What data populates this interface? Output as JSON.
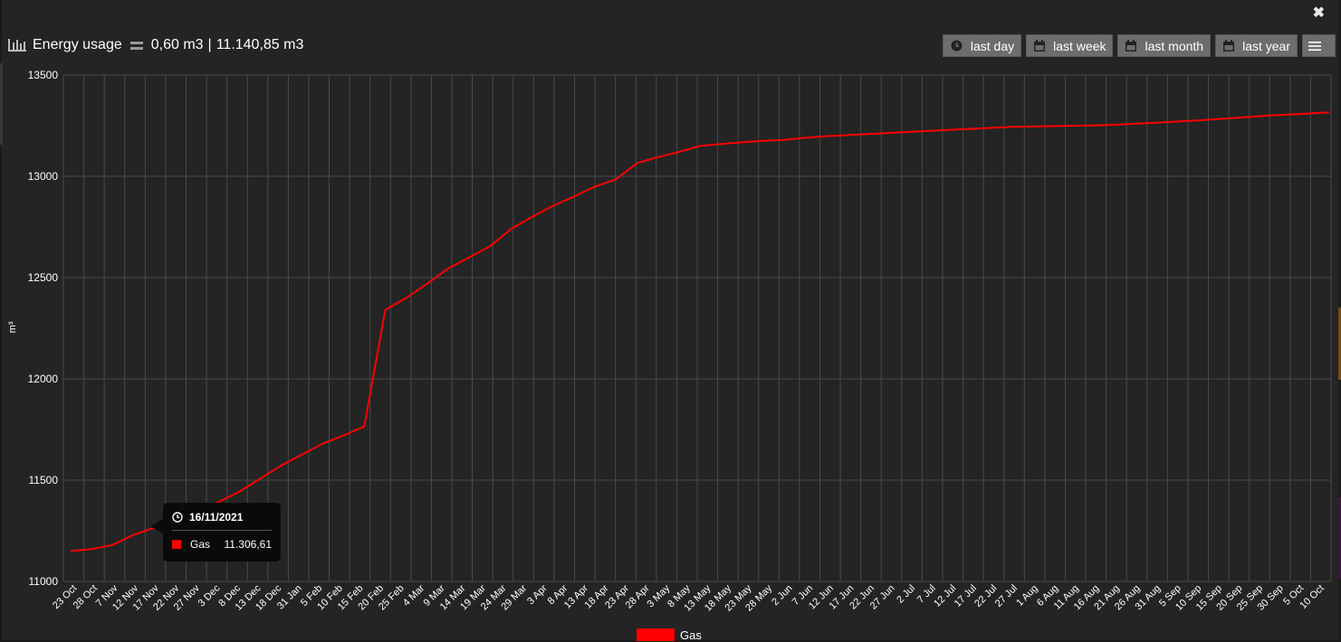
{
  "header": {
    "title": "Energy usage",
    "current_value": "0,60 m3",
    "separator": "|",
    "total_value": "11.140,85 m3"
  },
  "buttons": [
    {
      "label": "last day",
      "icon": "clock-icon"
    },
    {
      "label": "last week",
      "icon": "calendar-icon"
    },
    {
      "label": "last month",
      "icon": "calendar-icon"
    },
    {
      "label": "last year",
      "icon": "calendar-icon"
    }
  ],
  "menu_icon": "hamburger-menu-icon",
  "close_icon": "close-icon",
  "colors": {
    "series": "#ff0000",
    "background": "#242424",
    "grid": "#4a4a4a",
    "button": "#6d6d6d"
  },
  "tooltip": {
    "date": "16/11/2021",
    "series": "Gas",
    "value": "11.306,61"
  },
  "chart_data": {
    "type": "line",
    "ylabel": "m³",
    "xlabel": "",
    "ylim": [
      11000,
      13500
    ],
    "yticks": [
      11000,
      11500,
      12000,
      12500,
      13000,
      13500
    ],
    "grid": true,
    "legend": "bottom-center",
    "x_tick_labels": [
      "23 Oct",
      "28 Oct",
      "7 Nov",
      "12 Nov",
      "17 Nov",
      "22 Nov",
      "27 Nov",
      "3 Dec",
      "8 Dec",
      "13 Dec",
      "18 Dec",
      "31 Jan",
      "5 Feb",
      "10 Feb",
      "15 Feb",
      "20 Feb",
      "25 Feb",
      "4 Mar",
      "9 Mar",
      "14 Mar",
      "19 Mar",
      "24 Mar",
      "29 Mar",
      "3 Apr",
      "8 Apr",
      "13 Apr",
      "18 Apr",
      "23 Apr",
      "28 Apr",
      "3 May",
      "8 May",
      "13 May",
      "18 May",
      "23 May",
      "28 May",
      "2 Jun",
      "7 Jun",
      "12 Jun",
      "17 Jun",
      "22 Jun",
      "27 Jun",
      "2 Jul",
      "7 Jul",
      "12 Jul",
      "17 Jul",
      "22 Jul",
      "27 Jul",
      "1 Aug",
      "6 Aug",
      "11 Aug",
      "16 Aug",
      "21 Aug",
      "26 Aug",
      "31 Aug",
      "5 Sep",
      "10 Sep",
      "15 Sep",
      "20 Sep",
      "25 Sep",
      "30 Sep",
      "5 Oct",
      "10 Oct"
    ],
    "series": [
      {
        "name": "Gas",
        "color": "#ff0000",
        "values": [
          11150,
          11160,
          11180,
          11230,
          11265,
          11300,
          11345,
          11390,
          11440,
          11505,
          11570,
          11625,
          11680,
          11720,
          11765,
          12340,
          12400,
          12470,
          12545,
          12600,
          12655,
          12740,
          12800,
          12855,
          12900,
          12950,
          12985,
          13065,
          13095,
          13120,
          13150,
          13160,
          13168,
          13175,
          13180,
          13190,
          13198,
          13203,
          13209,
          13214,
          13219,
          13225,
          13230,
          13235,
          13240,
          13244,
          13246,
          13248,
          13250,
          13252,
          13256,
          13261,
          13266,
          13272,
          13278,
          13285,
          13292,
          13299,
          13305,
          13310,
          13316
        ]
      }
    ]
  }
}
